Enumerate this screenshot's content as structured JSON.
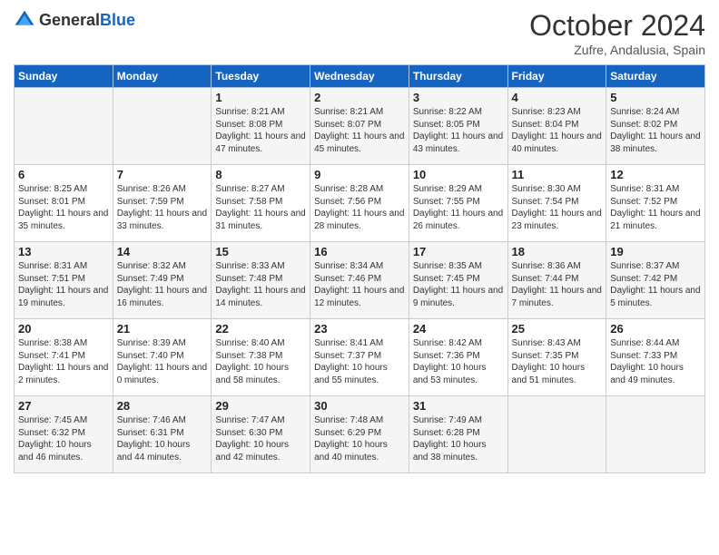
{
  "header": {
    "logo_general": "General",
    "logo_blue": "Blue",
    "month": "October 2024",
    "location": "Zufre, Andalusia, Spain"
  },
  "days_of_week": [
    "Sunday",
    "Monday",
    "Tuesday",
    "Wednesday",
    "Thursday",
    "Friday",
    "Saturday"
  ],
  "weeks": [
    [
      {
        "day": "",
        "info": ""
      },
      {
        "day": "",
        "info": ""
      },
      {
        "day": "1",
        "info": "Sunrise: 8:21 AM\nSunset: 8:08 PM\nDaylight: 11 hours and 47 minutes."
      },
      {
        "day": "2",
        "info": "Sunrise: 8:21 AM\nSunset: 8:07 PM\nDaylight: 11 hours and 45 minutes."
      },
      {
        "day": "3",
        "info": "Sunrise: 8:22 AM\nSunset: 8:05 PM\nDaylight: 11 hours and 43 minutes."
      },
      {
        "day": "4",
        "info": "Sunrise: 8:23 AM\nSunset: 8:04 PM\nDaylight: 11 hours and 40 minutes."
      },
      {
        "day": "5",
        "info": "Sunrise: 8:24 AM\nSunset: 8:02 PM\nDaylight: 11 hours and 38 minutes."
      }
    ],
    [
      {
        "day": "6",
        "info": "Sunrise: 8:25 AM\nSunset: 8:01 PM\nDaylight: 11 hours and 35 minutes."
      },
      {
        "day": "7",
        "info": "Sunrise: 8:26 AM\nSunset: 7:59 PM\nDaylight: 11 hours and 33 minutes."
      },
      {
        "day": "8",
        "info": "Sunrise: 8:27 AM\nSunset: 7:58 PM\nDaylight: 11 hours and 31 minutes."
      },
      {
        "day": "9",
        "info": "Sunrise: 8:28 AM\nSunset: 7:56 PM\nDaylight: 11 hours and 28 minutes."
      },
      {
        "day": "10",
        "info": "Sunrise: 8:29 AM\nSunset: 7:55 PM\nDaylight: 11 hours and 26 minutes."
      },
      {
        "day": "11",
        "info": "Sunrise: 8:30 AM\nSunset: 7:54 PM\nDaylight: 11 hours and 23 minutes."
      },
      {
        "day": "12",
        "info": "Sunrise: 8:31 AM\nSunset: 7:52 PM\nDaylight: 11 hours and 21 minutes."
      }
    ],
    [
      {
        "day": "13",
        "info": "Sunrise: 8:31 AM\nSunset: 7:51 PM\nDaylight: 11 hours and 19 minutes."
      },
      {
        "day": "14",
        "info": "Sunrise: 8:32 AM\nSunset: 7:49 PM\nDaylight: 11 hours and 16 minutes."
      },
      {
        "day": "15",
        "info": "Sunrise: 8:33 AM\nSunset: 7:48 PM\nDaylight: 11 hours and 14 minutes."
      },
      {
        "day": "16",
        "info": "Sunrise: 8:34 AM\nSunset: 7:46 PM\nDaylight: 11 hours and 12 minutes."
      },
      {
        "day": "17",
        "info": "Sunrise: 8:35 AM\nSunset: 7:45 PM\nDaylight: 11 hours and 9 minutes."
      },
      {
        "day": "18",
        "info": "Sunrise: 8:36 AM\nSunset: 7:44 PM\nDaylight: 11 hours and 7 minutes."
      },
      {
        "day": "19",
        "info": "Sunrise: 8:37 AM\nSunset: 7:42 PM\nDaylight: 11 hours and 5 minutes."
      }
    ],
    [
      {
        "day": "20",
        "info": "Sunrise: 8:38 AM\nSunset: 7:41 PM\nDaylight: 11 hours and 2 minutes."
      },
      {
        "day": "21",
        "info": "Sunrise: 8:39 AM\nSunset: 7:40 PM\nDaylight: 11 hours and 0 minutes."
      },
      {
        "day": "22",
        "info": "Sunrise: 8:40 AM\nSunset: 7:38 PM\nDaylight: 10 hours and 58 minutes."
      },
      {
        "day": "23",
        "info": "Sunrise: 8:41 AM\nSunset: 7:37 PM\nDaylight: 10 hours and 55 minutes."
      },
      {
        "day": "24",
        "info": "Sunrise: 8:42 AM\nSunset: 7:36 PM\nDaylight: 10 hours and 53 minutes."
      },
      {
        "day": "25",
        "info": "Sunrise: 8:43 AM\nSunset: 7:35 PM\nDaylight: 10 hours and 51 minutes."
      },
      {
        "day": "26",
        "info": "Sunrise: 8:44 AM\nSunset: 7:33 PM\nDaylight: 10 hours and 49 minutes."
      }
    ],
    [
      {
        "day": "27",
        "info": "Sunrise: 7:45 AM\nSunset: 6:32 PM\nDaylight: 10 hours and 46 minutes."
      },
      {
        "day": "28",
        "info": "Sunrise: 7:46 AM\nSunset: 6:31 PM\nDaylight: 10 hours and 44 minutes."
      },
      {
        "day": "29",
        "info": "Sunrise: 7:47 AM\nSunset: 6:30 PM\nDaylight: 10 hours and 42 minutes."
      },
      {
        "day": "30",
        "info": "Sunrise: 7:48 AM\nSunset: 6:29 PM\nDaylight: 10 hours and 40 minutes."
      },
      {
        "day": "31",
        "info": "Sunrise: 7:49 AM\nSunset: 6:28 PM\nDaylight: 10 hours and 38 minutes."
      },
      {
        "day": "",
        "info": ""
      },
      {
        "day": "",
        "info": ""
      }
    ]
  ]
}
